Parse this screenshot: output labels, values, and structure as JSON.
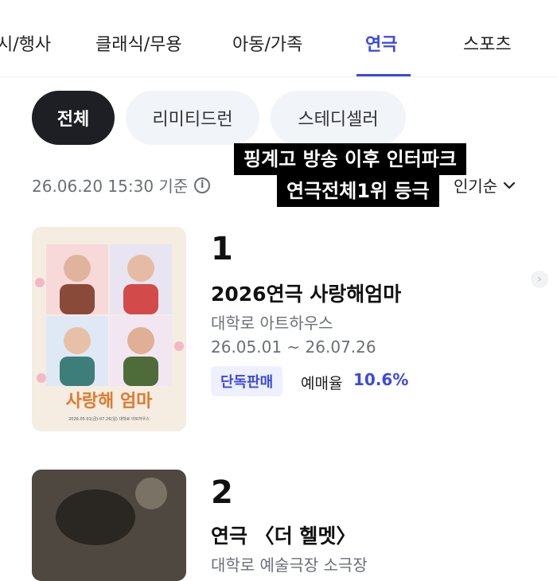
{
  "tabs": [
    {
      "label": "시/행사"
    },
    {
      "label": "클래식/무용"
    },
    {
      "label": "아동/가족"
    },
    {
      "label": "연극"
    },
    {
      "label": "스포츠"
    }
  ],
  "active_tab": "연극",
  "accent_color": "#3b49df",
  "filters": [
    {
      "label": "전체"
    },
    {
      "label": "리미티드런"
    },
    {
      "label": "스테디셀러"
    }
  ],
  "active_filter": "전체",
  "timestamp": "26.06.20 15:30 기준",
  "info_icon": "i",
  "sort": {
    "label": "인기순",
    "icon": "chevron-down"
  },
  "caption": {
    "line1": "핑계고 방송 이후 인터파크",
    "line2": "연극전체1위 등극"
  },
  "items": [
    {
      "rank": "1",
      "title": "2026연극 사랑해엄마",
      "venue": "대학로 아트하우스",
      "period": "26.05.01 ~ 26.07.26",
      "badge": "단독판매",
      "rate_label": "예매율",
      "rate_value": "10.6%",
      "poster_title": "사랑해 엄마",
      "poster_dates": "2026.05.01(금)-07.26(일) 대학로 아트하우스"
    },
    {
      "rank": "2",
      "title": "연극 〈더 헬멧〉",
      "venue": "대학로 예술극장 소극장"
    }
  ]
}
